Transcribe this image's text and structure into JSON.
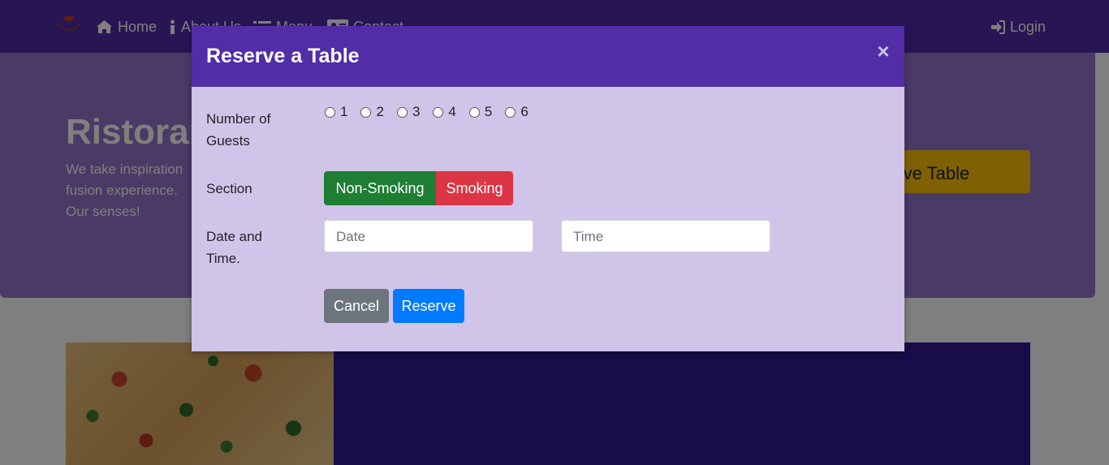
{
  "navbar": {
    "items": [
      {
        "label": "Home",
        "icon": "home-icon"
      },
      {
        "label": "About Us",
        "icon": "info-icon"
      },
      {
        "label": "Menu",
        "icon": "list-icon"
      },
      {
        "label": "Contact",
        "icon": "address-card-icon"
      }
    ],
    "login": {
      "label": "Login",
      "icon": "sign-in-icon"
    }
  },
  "jumbotron": {
    "title": "Ristorante",
    "text": "We take inspiration fusion experience. Our senses!",
    "reserve_button": "Reserve Table"
  },
  "modal": {
    "title": "Reserve a Table",
    "close_label": "×",
    "guests": {
      "label": "Number of Guests",
      "options": [
        "1",
        "2",
        "3",
        "4",
        "5",
        "6"
      ]
    },
    "section": {
      "label": "Section",
      "options": [
        "Non-Smoking",
        "Smoking"
      ]
    },
    "datetime": {
      "label": "Date and Time.",
      "date_placeholder": "Date",
      "time_placeholder": "Time"
    },
    "buttons": {
      "cancel": "Cancel",
      "reserve": "Reserve"
    }
  },
  "colors": {
    "primary": "#512da8",
    "light_primary": "#d1c4e9",
    "success": "#1e7e34",
    "danger": "#dc3545",
    "secondary": "#6c757d",
    "blue": "#007bff",
    "warning": "#ffc107"
  }
}
